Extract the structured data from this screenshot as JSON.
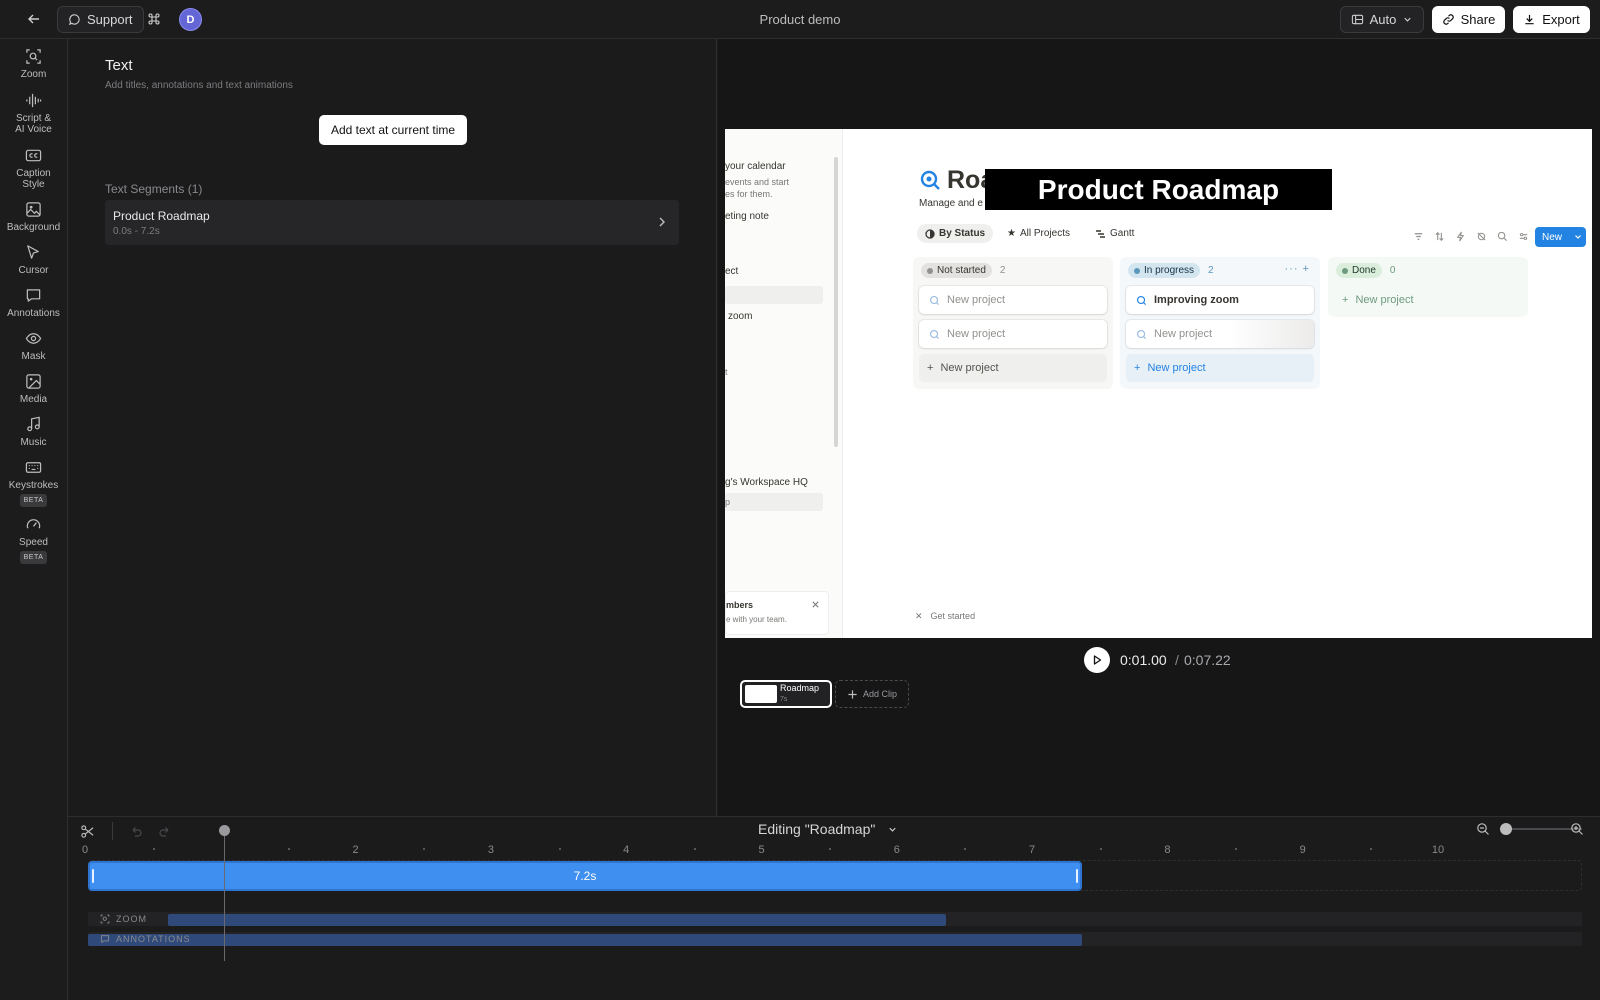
{
  "topbar": {
    "support_label": "Support",
    "avatar_initial": "D",
    "title": "Product demo",
    "auto_label": "Auto",
    "share_label": "Share",
    "export_label": "Export"
  },
  "sidebar": {
    "items": [
      {
        "label": "Zoom",
        "icon": "zoom-icon"
      },
      {
        "label": "Script &\nAI Voice",
        "icon": "waveform-icon"
      },
      {
        "label": "Caption\nStyle",
        "icon": "caption-icon"
      },
      {
        "label": "Background",
        "icon": "image-icon"
      },
      {
        "label": "Cursor",
        "icon": "cursor-icon"
      },
      {
        "label": "Annotations",
        "icon": "comment-icon"
      },
      {
        "label": "Mask",
        "icon": "eye-icon"
      },
      {
        "label": "Media",
        "icon": "media-icon"
      },
      {
        "label": "Music",
        "icon": "music-icon"
      },
      {
        "label": "Keystrokes",
        "icon": "keyboard-icon",
        "badge": "BETA"
      },
      {
        "label": "Speed",
        "icon": "gauge-icon",
        "badge": "BETA"
      }
    ]
  },
  "panel": {
    "title": "Text",
    "subtitle": "Add titles, annotations and text animations",
    "add_button": "Add text at current time",
    "segments_header": "Text Segments (1)",
    "segments": [
      {
        "name": "Product Roadmap",
        "time": "0.0s - 7.2s"
      }
    ]
  },
  "preview": {
    "overlay_text": "Product Roadmap",
    "board_title": "Roa",
    "board_subtitle": "Manage and e",
    "sidebar_lines": [
      "your calendar",
      "eting note",
      "ect",
      "zoom",
      "t",
      "g's Workspace HQ",
      "p"
    ],
    "sidebar_small": "events and start\nes for them.",
    "members_title": "mbers",
    "members_sub": "e with your team.",
    "tabs": [
      "By Status",
      "All Projects",
      "Gantt"
    ],
    "new_label": "New",
    "columns": [
      {
        "name": "Not started",
        "count": "2",
        "cards": [
          "New project",
          "New project"
        ],
        "add": "New project",
        "bg": "#f7f7f5",
        "pill": "#e3e2e0",
        "dot": "#91918e"
      },
      {
        "name": "In progress",
        "count": "2",
        "cards": [
          "Improving zoom",
          "New project"
        ],
        "add": "New project",
        "bg": "#f4f8fb",
        "pill": "#d3e5ef",
        "dot": "#5b97bd"
      },
      {
        "name": "Done",
        "count": "0",
        "cards": [],
        "add": "New project",
        "bg": "#f5f9f6",
        "pill": "#dbeddb",
        "dot": "#6c9b7d"
      }
    ],
    "get_started": "Get started",
    "time_current": "0:01.00",
    "time_sep": "/",
    "time_total": "0:07.22",
    "clip_name": "Roadmap",
    "clip_duration": "7s",
    "add_clip": "Add Clip"
  },
  "timeline": {
    "editing_label": "Editing \"Roadmap\"",
    "ticks": [
      "0",
      "",
      "2",
      "3",
      "4",
      "5",
      "6",
      "7",
      "8",
      "9",
      "10"
    ],
    "clip_label": "7.2s",
    "tracks": [
      {
        "label": "ZOOM",
        "icon": "zoom-icon"
      },
      {
        "label": "ANNOTATIONS",
        "icon": "comment-icon"
      }
    ]
  },
  "colors": {
    "accent": "#3f8ff0",
    "background": "#1b1b1c",
    "avatar": "#6466d6",
    "notion_blue": "#2383e2"
  }
}
